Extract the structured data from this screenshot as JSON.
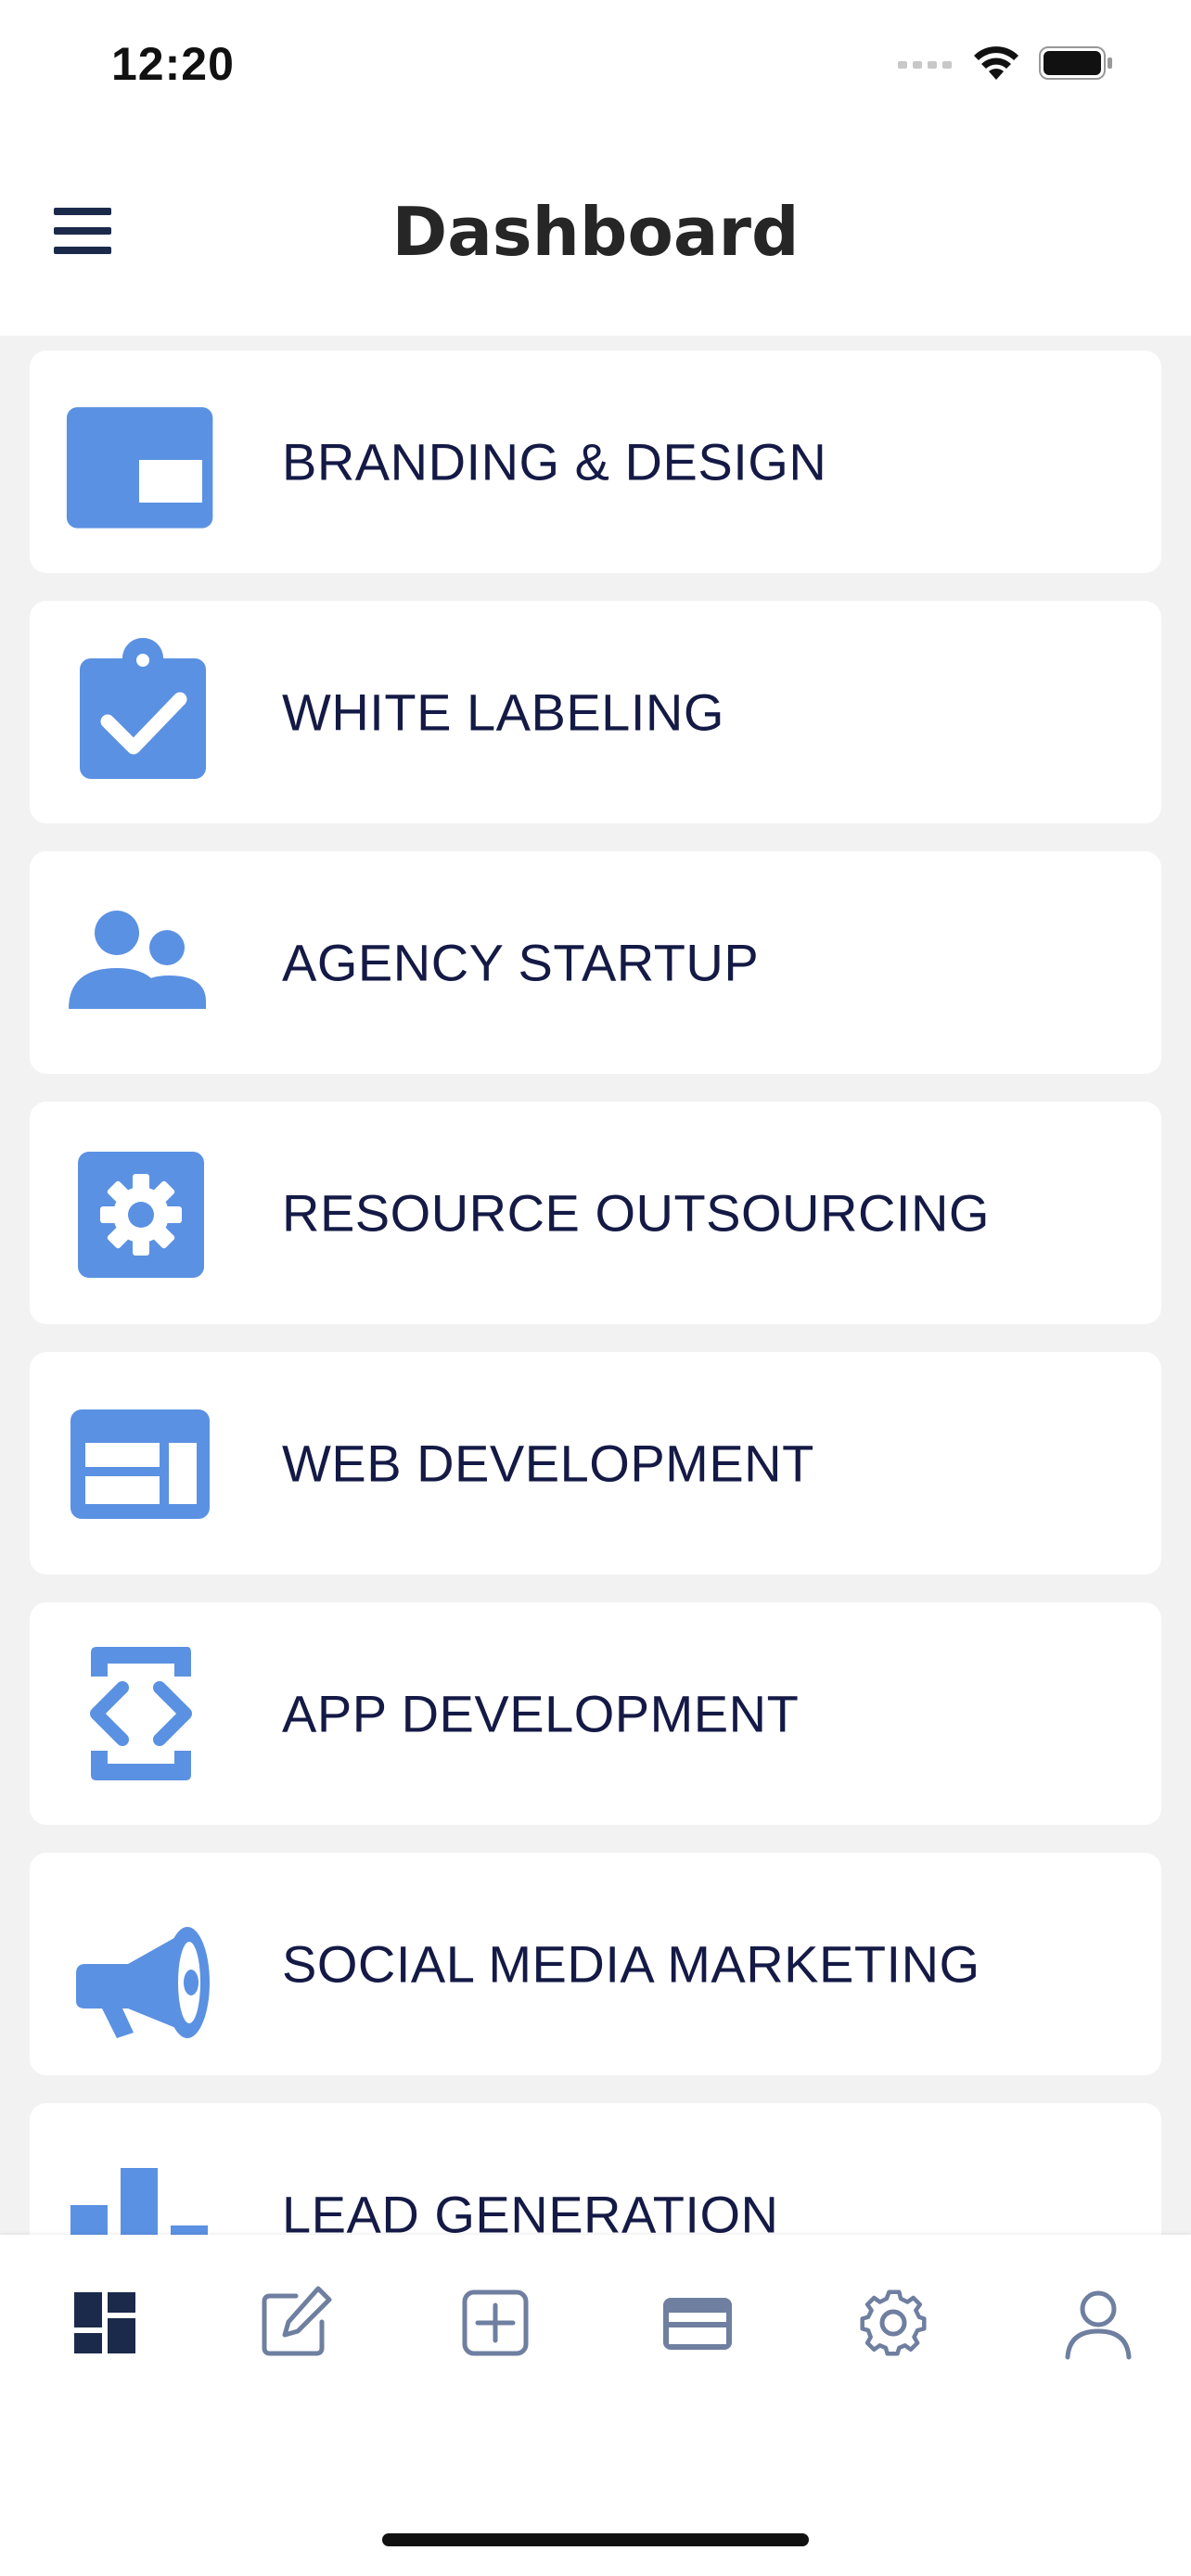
{
  "status_bar": {
    "time": "12:20"
  },
  "header": {
    "title": "Dashboard"
  },
  "services": [
    {
      "label": "BRANDING & DESIGN",
      "icon": "branding-icon"
    },
    {
      "label": "WHITE LABELING",
      "icon": "clipboard-check-icon"
    },
    {
      "label": "AGENCY STARTUP",
      "icon": "people-icon"
    },
    {
      "label": "RESOURCE OUTSOURCING",
      "icon": "gear-box-icon"
    },
    {
      "label": "WEB DEVELOPMENT",
      "icon": "web-layout-icon"
    },
    {
      "label": "APP DEVELOPMENT",
      "icon": "code-device-icon"
    },
    {
      "label": "SOCIAL MEDIA MARKETING",
      "icon": "megaphone-icon"
    },
    {
      "label": "LEAD GENERATION",
      "icon": "bar-chart-icon"
    }
  ],
  "tabs": [
    {
      "icon": "dashboard-icon",
      "active": true
    },
    {
      "icon": "edit-icon",
      "active": false
    },
    {
      "icon": "add-icon",
      "active": false
    },
    {
      "icon": "card-icon",
      "active": false
    },
    {
      "icon": "settings-icon",
      "active": false
    },
    {
      "icon": "profile-icon",
      "active": false
    }
  ],
  "colors": {
    "accent": "#5b91e2",
    "label_text": "#141a45",
    "tab_active": "#1b2a4a",
    "tab_inactive": "#6f7fa0",
    "background": "#f2f2f2"
  }
}
